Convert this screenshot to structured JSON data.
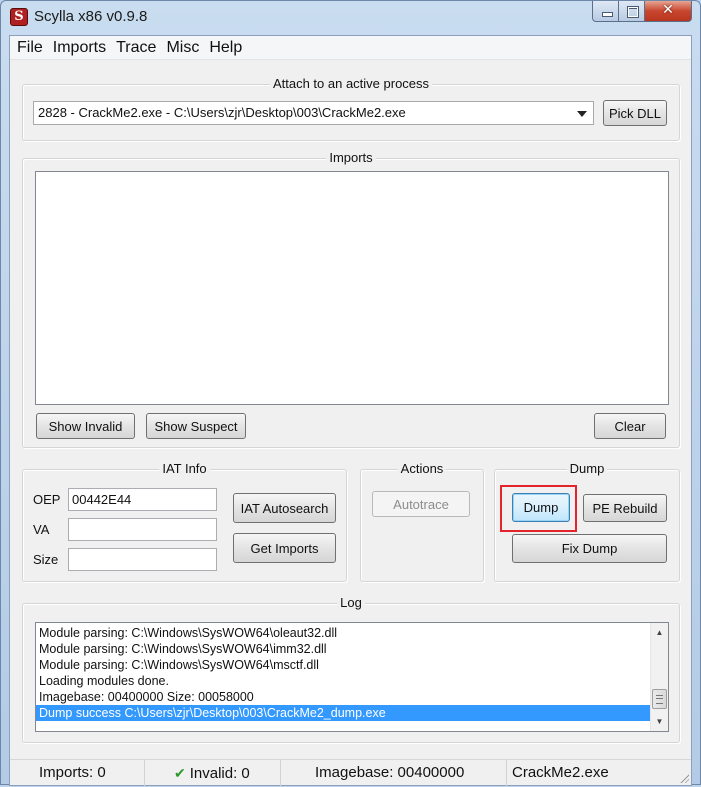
{
  "window": {
    "title": "Scylla x86 v0.9.8",
    "close_glyph": "✕"
  },
  "menu": {
    "items": [
      "File",
      "Imports",
      "Trace",
      "Misc",
      "Help"
    ]
  },
  "attach": {
    "group_title": "Attach to an active process",
    "process_selected": "2828 - CrackMe2.exe - C:\\Users\\zjr\\Desktop\\003\\CrackMe2.exe",
    "pick_dll_label": "Pick DLL"
  },
  "imports": {
    "group_title": "Imports",
    "show_invalid_label": "Show Invalid",
    "show_suspect_label": "Show Suspect",
    "clear_label": "Clear"
  },
  "iat_info": {
    "group_title": "IAT Info",
    "oep_label": "OEP",
    "oep_value": "00442E44",
    "va_label": "VA",
    "va_value": "",
    "size_label": "Size",
    "size_value": "",
    "iat_autosearch_label": "IAT Autosearch",
    "get_imports_label": "Get Imports"
  },
  "actions": {
    "group_title": "Actions",
    "autotrace_label": "Autotrace"
  },
  "dump": {
    "group_title": "Dump",
    "dump_label": "Dump",
    "pe_rebuild_label": "PE Rebuild",
    "fix_dump_label": "Fix Dump",
    "highlight_color": "#e3242b"
  },
  "log": {
    "group_title": "Log",
    "lines": [
      "Module parsing: C:\\Windows\\SysWOW64\\oleaut32.dll",
      "Module parsing: C:\\Windows\\SysWOW64\\imm32.dll",
      "Module parsing: C:\\Windows\\SysWOW64\\msctf.dll",
      "Loading modules done.",
      "Imagebase: 00400000 Size: 00058000",
      "Dump success C:\\Users\\zjr\\Desktop\\003\\CrackMe2_dump.exe"
    ],
    "selected_index": 5,
    "selection_color": "#3399ff"
  },
  "status": {
    "imports": "Imports: 0",
    "invalid": "Invalid: 0",
    "imagebase": "Imagebase: 00400000",
    "module": "CrackMe2.exe",
    "invalid_icon": "checkmark-icon"
  }
}
